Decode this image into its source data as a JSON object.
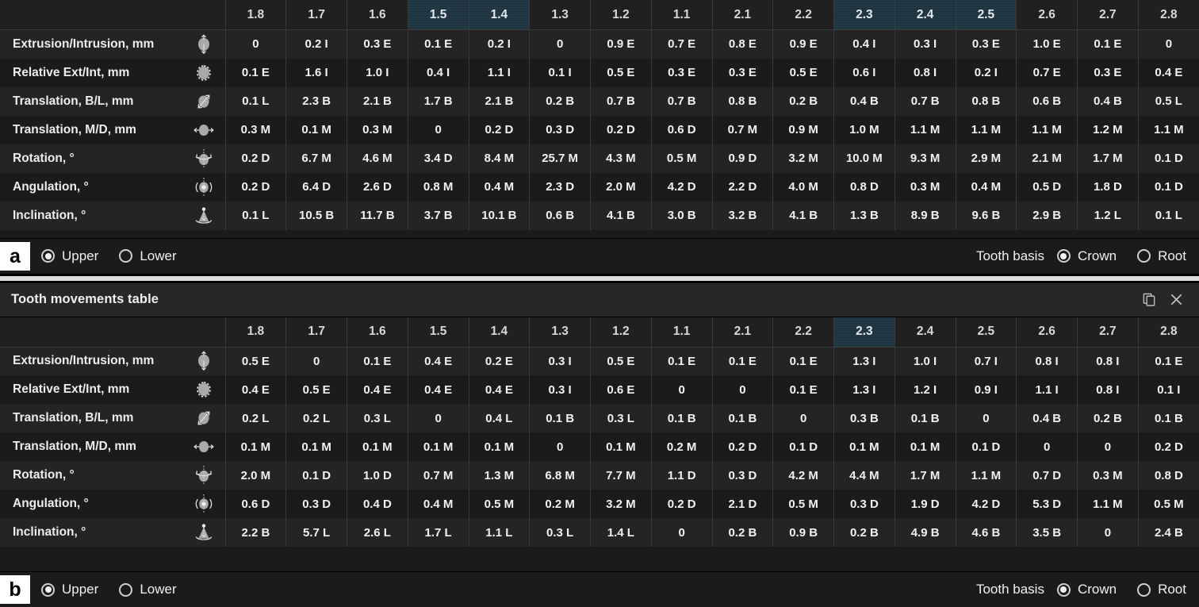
{
  "panels": [
    {
      "key": "a",
      "panel_label": "a",
      "show_titlebar": false,
      "title": "Tooth movements table",
      "columns": [
        "1.8",
        "1.7",
        "1.6",
        "1.5",
        "1.4",
        "1.3",
        "1.2",
        "1.1",
        "2.1",
        "2.2",
        "2.3",
        "2.4",
        "2.5",
        "2.6",
        "2.7",
        "2.8"
      ],
      "highlighted_columns": [
        "1.5",
        "1.4",
        "2.3",
        "2.4",
        "2.5"
      ],
      "rows": [
        {
          "label": "Extrusion/Intrusion, mm",
          "icon": "extrusion-intrusion-icon",
          "values": [
            "0",
            "0.2 I",
            "0.3 E",
            "0.1 E",
            "0.2 I",
            "0",
            "0.9 E",
            "0.7 E",
            "0.8 E",
            "0.9 E",
            "0.4 I",
            "0.3 I",
            "0.3 E",
            "1.0 E",
            "0.1 E",
            "0"
          ]
        },
        {
          "label": "Relative Ext/Int, mm",
          "icon": "relative-ext-int-icon",
          "values": [
            "0.1 E",
            "1.6 I",
            "1.0 I",
            "0.4 I",
            "1.1 I",
            "0.1 I",
            "0.5 E",
            "0.3 E",
            "0.3 E",
            "0.5 E",
            "0.6 I",
            "0.8 I",
            "0.2 I",
            "0.7 E",
            "0.3 E",
            "0.4 E"
          ]
        },
        {
          "label": "Translation, B/L, mm",
          "icon": "translation-bl-icon",
          "values": [
            "0.1 L",
            "2.3 B",
            "2.1 B",
            "1.7 B",
            "2.1 B",
            "0.2 B",
            "0.7 B",
            "0.7 B",
            "0.8 B",
            "0.2 B",
            "0.4 B",
            "0.7 B",
            "0.8 B",
            "0.6 B",
            "0.4 B",
            "0.5 L"
          ]
        },
        {
          "label": "Translation, M/D, mm",
          "icon": "translation-md-icon",
          "values": [
            "0.3 M",
            "0.1 M",
            "0.3 M",
            "0",
            "0.2 D",
            "0.3 D",
            "0.2 D",
            "0.6 D",
            "0.7 M",
            "0.9 M",
            "1.0 M",
            "1.1 M",
            "1.1 M",
            "1.1 M",
            "1.2 M",
            "1.1 M"
          ]
        },
        {
          "label": "Rotation, °",
          "icon": "rotation-icon",
          "values": [
            "0.2 D",
            "6.7 M",
            "4.6 M",
            "3.4 D",
            "8.4 M",
            "25.7 M",
            "4.3 M",
            "0.5 M",
            "0.9 D",
            "3.2 M",
            "10.0 M",
            "9.3 M",
            "2.9 M",
            "2.1 M",
            "1.7 M",
            "0.1 D"
          ]
        },
        {
          "label": "Angulation, °",
          "icon": "angulation-icon",
          "values": [
            "0.2 D",
            "6.4 D",
            "2.6 D",
            "0.8 M",
            "0.4 M",
            "2.3 D",
            "2.0 M",
            "4.2 D",
            "2.2 D",
            "4.0 M",
            "0.8 D",
            "0.3 M",
            "0.4 M",
            "0.5 D",
            "1.8 D",
            "0.1 D"
          ]
        },
        {
          "label": "Inclination, °",
          "icon": "inclination-icon",
          "values": [
            "0.1 L",
            "10.5 B",
            "11.7 B",
            "3.7 B",
            "10.1 B",
            "0.6 B",
            "4.1 B",
            "3.0 B",
            "3.2 B",
            "4.1 B",
            "1.3 B",
            "8.9 B",
            "9.6 B",
            "2.9 B",
            "1.2 L",
            "0.1 L"
          ]
        }
      ],
      "controls": {
        "arch_options": [
          {
            "label": "Upper",
            "selected": true
          },
          {
            "label": "Lower",
            "selected": false
          }
        ],
        "basis_label": "Tooth basis",
        "basis_options": [
          {
            "label": "Crown",
            "selected": true
          },
          {
            "label": "Root",
            "selected": false
          }
        ]
      }
    },
    {
      "key": "b",
      "panel_label": "b",
      "show_titlebar": true,
      "title": "Tooth movements table",
      "titlebar_icons": [
        {
          "name": "copy-icon",
          "glyph": "copy"
        },
        {
          "name": "close-icon",
          "glyph": "close"
        }
      ],
      "columns": [
        "1.8",
        "1.7",
        "1.6",
        "1.5",
        "1.4",
        "1.3",
        "1.2",
        "1.1",
        "2.1",
        "2.2",
        "2.3",
        "2.4",
        "2.5",
        "2.6",
        "2.7",
        "2.8"
      ],
      "highlighted_columns": [
        "2.3"
      ],
      "rows": [
        {
          "label": "Extrusion/Intrusion, mm",
          "icon": "extrusion-intrusion-icon",
          "values": [
            "0.5 E",
            "0",
            "0.1 E",
            "0.4 E",
            "0.2 E",
            "0.3 I",
            "0.5 E",
            "0.1 E",
            "0.1 E",
            "0.1 E",
            "1.3 I",
            "1.0 I",
            "0.7 I",
            "0.8 I",
            "0.8 I",
            "0.1 E"
          ]
        },
        {
          "label": "Relative Ext/Int, mm",
          "icon": "relative-ext-int-icon",
          "values": [
            "0.4 E",
            "0.5 E",
            "0.4 E",
            "0.4 E",
            "0.4 E",
            "0.3 I",
            "0.6 E",
            "0",
            "0",
            "0.1 E",
            "1.3 I",
            "1.2 I",
            "0.9 I",
            "1.1 I",
            "0.8 I",
            "0.1 I"
          ]
        },
        {
          "label": "Translation, B/L, mm",
          "icon": "translation-bl-icon",
          "values": [
            "0.2 L",
            "0.2 L",
            "0.3 L",
            "0",
            "0.4 L",
            "0.1 B",
            "0.3 L",
            "0.1 B",
            "0.1 B",
            "0",
            "0.3 B",
            "0.1 B",
            "0",
            "0.4 B",
            "0.2 B",
            "0.1 B"
          ]
        },
        {
          "label": "Translation, M/D, mm",
          "icon": "translation-md-icon",
          "values": [
            "0.1 M",
            "0.1 M",
            "0.1 M",
            "0.1 M",
            "0.1 M",
            "0",
            "0.1 M",
            "0.2 M",
            "0.2 D",
            "0.1 D",
            "0.1 M",
            "0.1 M",
            "0.1 D",
            "0",
            "0",
            "0.2 D"
          ]
        },
        {
          "label": "Rotation, °",
          "icon": "rotation-icon",
          "values": [
            "2.0 M",
            "0.1 D",
            "1.0 D",
            "0.7 M",
            "1.3 M",
            "6.8 M",
            "7.7 M",
            "1.1 D",
            "0.3 D",
            "4.2 M",
            "4.4 M",
            "1.7 M",
            "1.1 M",
            "0.7 D",
            "0.3 M",
            "0.8 D"
          ]
        },
        {
          "label": "Angulation, °",
          "icon": "angulation-icon",
          "values": [
            "0.6 D",
            "0.3 D",
            "0.4 D",
            "0.4 M",
            "0.5 M",
            "0.2 M",
            "3.2 M",
            "0.2 D",
            "2.1 D",
            "0.5 M",
            "0.3 D",
            "1.9 D",
            "4.2 D",
            "5.3 D",
            "1.1 M",
            "0.5 M"
          ]
        },
        {
          "label": "Inclination, °",
          "icon": "inclination-icon",
          "values": [
            "2.2 B",
            "5.7 L",
            "2.6 L",
            "1.7 L",
            "1.1 L",
            "0.3 L",
            "1.4 L",
            "0",
            "0.2 B",
            "0.9 B",
            "0.2 B",
            "4.9 B",
            "4.6 B",
            "3.5 B",
            "0",
            "2.4 B"
          ]
        }
      ],
      "controls": {
        "arch_options": [
          {
            "label": "Upper",
            "selected": true
          },
          {
            "label": "Lower",
            "selected": false
          }
        ],
        "basis_label": "Tooth basis",
        "basis_options": [
          {
            "label": "Crown",
            "selected": true
          },
          {
            "label": "Root",
            "selected": false
          }
        ]
      }
    }
  ],
  "colors": {
    "background": "#1b1b1b",
    "row_odd": "#242424",
    "row_even": "#1b1b1b",
    "header": "#202020",
    "highlight": "#1d3541",
    "grid": "#3a3a3a",
    "text": "#f2f2f2",
    "panel_label_bg": "#ffffff",
    "divider": "#dcdcdc"
  }
}
